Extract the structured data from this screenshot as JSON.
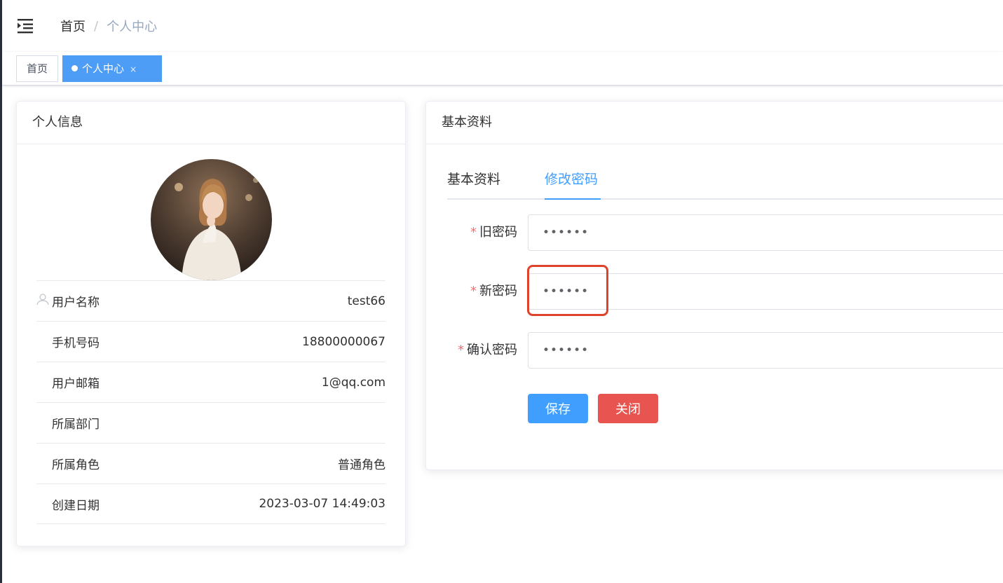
{
  "breadcrumb": {
    "home": "首页",
    "separator": "/",
    "current": "个人中心"
  },
  "tags": {
    "home": "首页",
    "active": "个人中心",
    "close_glyph": "×"
  },
  "profile": {
    "title": "个人信息",
    "rows": [
      {
        "label": "用户名称",
        "value": "test66"
      },
      {
        "label": "手机号码",
        "value": "18800000067"
      },
      {
        "label": "用户邮箱",
        "value": "1@qq.com"
      },
      {
        "label": "所属部门",
        "value": ""
      },
      {
        "label": "所属角色",
        "value": "普通角色"
      },
      {
        "label": "创建日期",
        "value": "2023-03-07 14:49:03"
      }
    ]
  },
  "settings": {
    "title": "基本资料",
    "tabs": [
      {
        "label": "基本资料",
        "active": false
      },
      {
        "label": "修改密码",
        "active": true
      }
    ],
    "required_mark": "*",
    "fields": [
      {
        "label": "旧密码",
        "value": "••••••"
      },
      {
        "label": "新密码",
        "value": "••••••"
      },
      {
        "label": "确认密码",
        "value": "••••••"
      }
    ],
    "save_label": "保存",
    "close_label": "关闭"
  },
  "colors": {
    "primary": "#409eff",
    "danger": "#e8544f",
    "highlight": "#e0432b",
    "required": "#f56c6c"
  }
}
